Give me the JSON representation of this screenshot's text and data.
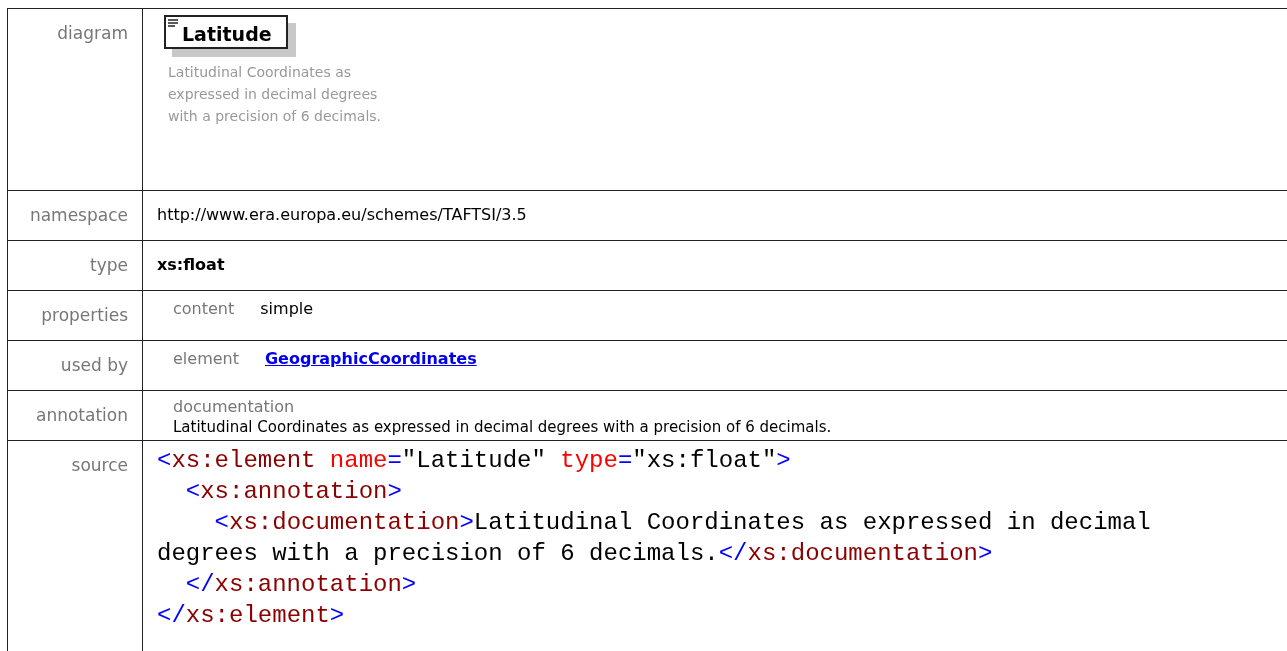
{
  "rows": [
    {
      "kind": "diagram",
      "label": "diagram",
      "element_name": "Latitude",
      "annotation": "Latitudinal Coordinates as expressed in decimal degrees with a precision of 6 decimals."
    },
    {
      "kind": "text",
      "label": "namespace",
      "value": "http://www.era.europa.eu/schemes/TAFTSI/3.5"
    },
    {
      "kind": "bold",
      "label": "type",
      "value": "xs:float"
    },
    {
      "kind": "pairs",
      "label": "properties",
      "pairs": [
        {
          "key": "content",
          "value": "simple",
          "link": false
        }
      ]
    },
    {
      "kind": "pairs",
      "label": "used by",
      "pairs": [
        {
          "key": "element",
          "value": "GeographicCoordinates",
          "link": true
        }
      ]
    },
    {
      "kind": "annotation",
      "label": "annotation",
      "heading": "documentation",
      "value": "Latitudinal Coordinates as expressed in decimal degrees with a precision of 6 decimals."
    },
    {
      "kind": "source",
      "label": "source",
      "lines": [
        [
          {
            "kind": "bracket",
            "text": "<"
          },
          {
            "kind": "tag",
            "text": "xs:element"
          },
          {
            "kind": "attr",
            "text": " name"
          },
          {
            "kind": "bracket",
            "text": "="
          },
          {
            "kind": "text",
            "text": "\"Latitude\""
          },
          {
            "kind": "attr",
            "text": " type"
          },
          {
            "kind": "bracket",
            "text": "="
          },
          {
            "kind": "text",
            "text": "\"xs:float\""
          },
          {
            "kind": "bracket",
            "text": ">"
          }
        ],
        [
          {
            "kind": "bracket",
            "text": "  <"
          },
          {
            "kind": "tag",
            "text": "xs:annotation"
          },
          {
            "kind": "bracket",
            "text": ">"
          }
        ],
        [
          {
            "kind": "bracket",
            "text": "    <"
          },
          {
            "kind": "tag",
            "text": "xs:documentation"
          },
          {
            "kind": "bracket",
            "text": ">"
          },
          {
            "kind": "text",
            "text": "Latitudinal Coordinates as expressed in decimal"
          }
        ],
        [
          {
            "kind": "text",
            "text": "degrees with a precision of 6 decimals."
          },
          {
            "kind": "bracket",
            "text": "</"
          },
          {
            "kind": "tag",
            "text": "xs:documentation"
          },
          {
            "kind": "bracket",
            "text": ">"
          }
        ],
        [
          {
            "kind": "bracket",
            "text": "  </"
          },
          {
            "kind": "tag",
            "text": "xs:annotation"
          },
          {
            "kind": "bracket",
            "text": ">"
          }
        ],
        [
          {
            "kind": "bracket",
            "text": "</"
          },
          {
            "kind": "tag",
            "text": "xs:element"
          },
          {
            "kind": "bracket",
            "text": ">"
          }
        ]
      ]
    }
  ]
}
